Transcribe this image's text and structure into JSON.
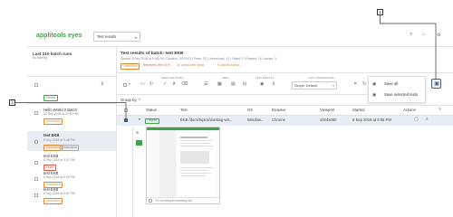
{
  "app": {
    "logo": "applitools eyes",
    "view_select": "Test results"
  },
  "colors": {
    "brand": "#3aa54a",
    "passed": "#3aa54a",
    "unresolved": "#e0862a",
    "failed": "#e25a4a"
  },
  "sidebar": {
    "title": "Last 210 batch runs",
    "subtitle": "No filtering",
    "passed_badge": "Passed",
    "batches": [
      {
        "name": "Hello World 2 Batch",
        "date": "12 Sep 2018 at 12:40 PM",
        "status": "Unresolved",
        "status2": "Unresolved"
      },
      {
        "name": "test EKB",
        "date": "8 Sep 2018 at 9:48 PM",
        "status": "Unresolved",
        "status2": "Unresolved"
      },
      {
        "name": "test EKB",
        "date": "8 Sep 2018 at 9:37 PM",
        "status": "Failed"
      },
      {
        "name": "test EKB",
        "date": "8 Sep 2018 at 9:05 PM",
        "status": "Unresolved"
      },
      {
        "name": "test EKB",
        "date": "8 Sep 2018 at 8:51 PM",
        "status": "Unresolved"
      }
    ]
  },
  "batch": {
    "title": "Test results of batch: test EKB",
    "meta": "Started: 8 Sep 2018 at 9:48 PM  |  Duration: 00:03:03  |  Tests: 32  |  Unresolved: 12  |  Failed: 2  |  Passed: 18  |  Issues: 3",
    "summary_badge": "Unresolved",
    "received": "Received 49% 41%",
    "unresolved_steps": "12 unresolved steps",
    "unsaved": "5 unsaved steps"
  },
  "toolbar": {
    "selected_tests": "SELECTED TESTS",
    "view": "VIEW",
    "test_results": "TEST RESULTS",
    "auto_maint": "AUTO MAINTENANCE",
    "scope": "Scope: Default"
  },
  "dropdown": {
    "save_all": "Save all",
    "save_selected": "Save selected tests"
  },
  "group_by": "Group by",
  "table": {
    "headers": [
      "Status",
      "Test",
      "OS",
      "Browser",
      "Viewport",
      "Started",
      "Actions"
    ],
    "row": {
      "status": "Passed",
      "test": "EKB /docs/topics/working-wit...",
      "os": "Window...",
      "browser": "Chrome",
      "viewport": "1024x680",
      "started": "8 Sep 2018 at 9:05 PM"
    }
  },
  "thumb_caption": "1/1 /docs/topics/working-wit...",
  "callouts": [
    "1",
    "2"
  ]
}
